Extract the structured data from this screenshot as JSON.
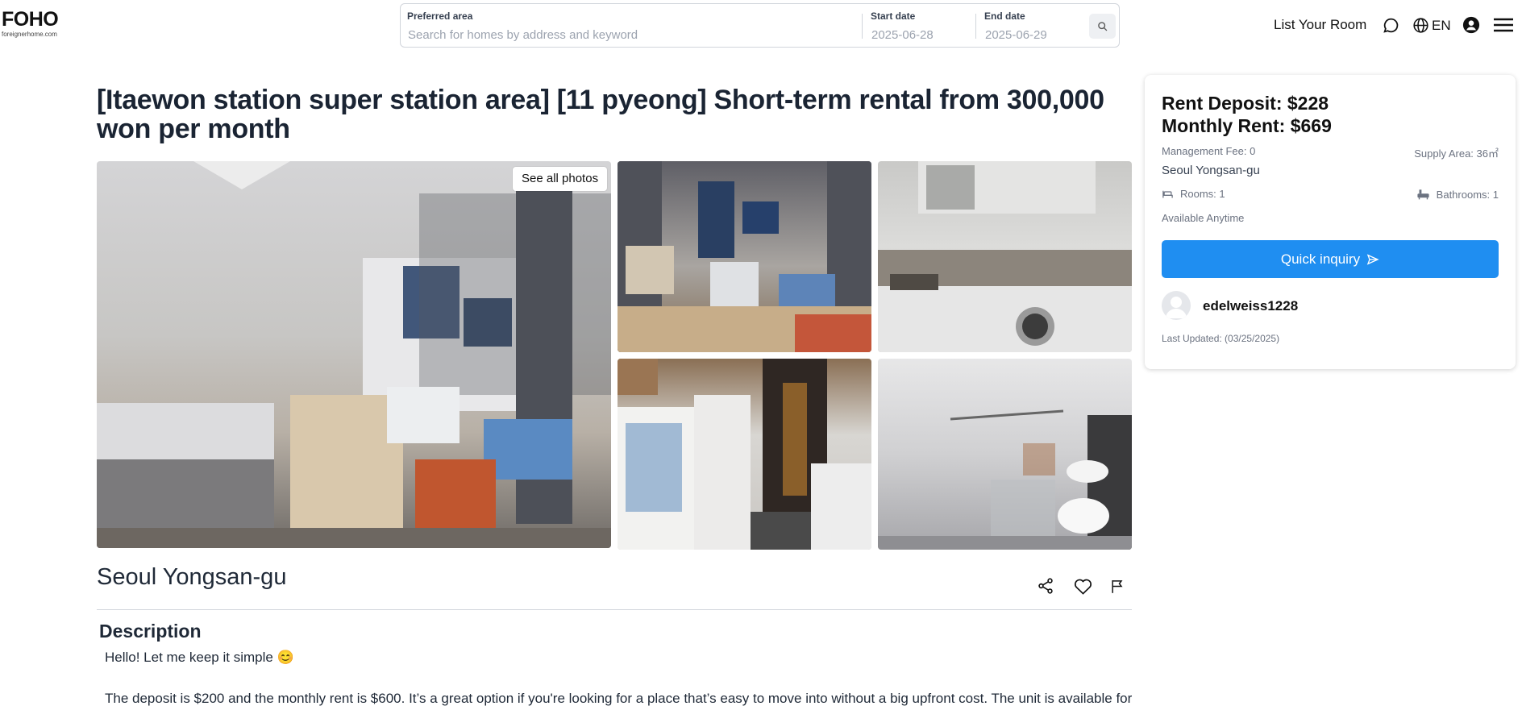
{
  "header": {
    "logo": {
      "main": "FOHO",
      "sub": "foreignerhome.com"
    },
    "search": {
      "area_label": "Preferred area",
      "area_placeholder": "Search for homes by address and keyword",
      "start_label": "Start date",
      "start_value": "2025-06-28",
      "end_label": "End date",
      "end_value": "2025-06-29",
      "search_icon": "search-icon"
    },
    "nav": {
      "list_room": "List Your Room",
      "chat_icon": "chat-icon",
      "globe_icon": "globe-icon",
      "language": "EN",
      "user_icon": "user-icon",
      "menu_icon": "menu-icon"
    }
  },
  "listing": {
    "title": "[Itaewon station super station area] [11 pyeong] Short-term rental from 300,000 won per month",
    "see_all_photos": "See all photos",
    "location": "Seoul Yongsan-gu",
    "actions": [
      "share-icon",
      "heart-icon",
      "flag-icon"
    ],
    "description": {
      "heading": "Description",
      "p1": "Hello! Let me keep it simple 😊",
      "p2": "The deposit is $200 and the monthly rent is $600. It’s a great option if you're looking for a place that’s easy to move into without a big upfront cost. The unit is available for"
    }
  },
  "card": {
    "deposit": "Rent Deposit: $228",
    "rent": "Monthly Rent: $669",
    "management_fee": "Management Fee: 0",
    "supply_area": "Supply Area: 36㎡",
    "region": "Seoul Yongsan-gu",
    "rooms": "Rooms: 1",
    "bathrooms": "Bathrooms: 1",
    "availability": "Available Anytime",
    "inquiry_button": "Quick inquiry",
    "username": "edelweiss1228",
    "last_updated": "Last Updated: (03/25/2025)"
  },
  "colors": {
    "accent": "#1f8ef1",
    "title": "#1a2433",
    "muted": "#6b7280",
    "border": "#d1d5db"
  }
}
